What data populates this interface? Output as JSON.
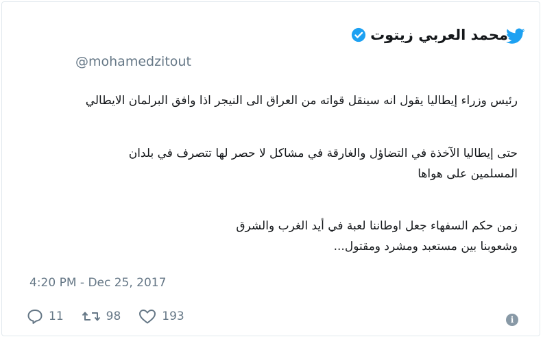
{
  "author": {
    "name": "محمد العربي زيتوت",
    "handle": "@mohamedzitout",
    "verified": true
  },
  "tweet": {
    "paragraphs": [
      {
        "lines": [
          "رئيس وزراء إيطاليا يقول انه سينقل قواته من العراق الى النيجر اذا وافق البرلمان الايطالي"
        ]
      },
      {
        "lines": [
          "حتى إيطاليا الآخذة في التضاؤل والغارقة في مشاكل لا حصر لها تتصرف في بلدان",
          "المسلمين على هواها"
        ]
      },
      {
        "lines": [
          "زمن حكم السفهاء جعل اوطاننا لعبة في أيد الغرب والشرق",
          "وشعوبنا بين مستعبد ومشرد ومقتول..."
        ]
      }
    ],
    "timestamp": "4:20 PM - Dec 25, 2017"
  },
  "actions": {
    "replies": "11",
    "retweets": "98",
    "likes": "193"
  },
  "colors": {
    "brand": "#1da1f2",
    "text": "#14171a",
    "muted": "#657786"
  },
  "icons": [
    "twitter-bird-icon",
    "verified-badge-icon",
    "reply-icon",
    "retweet-icon",
    "like-heart-icon",
    "info-icon"
  ]
}
